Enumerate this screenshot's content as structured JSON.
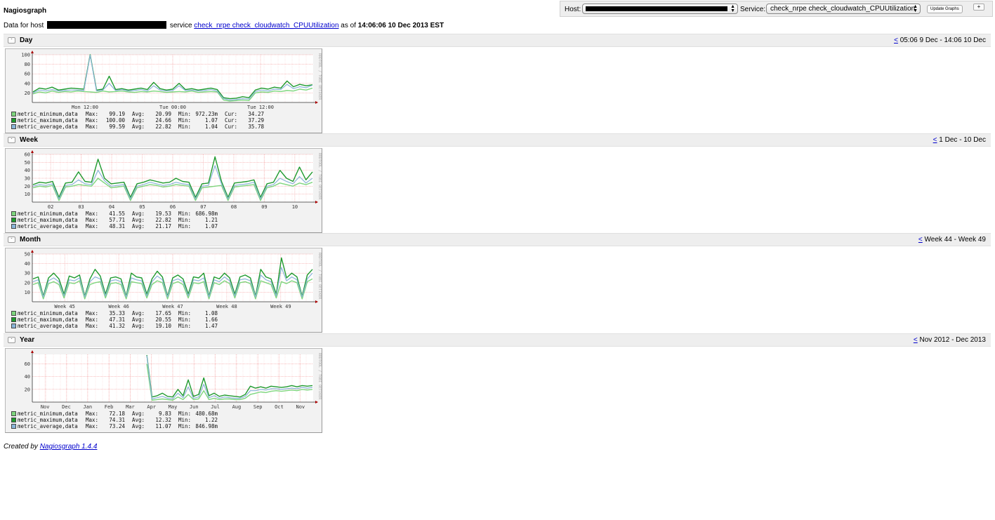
{
  "app_title": "Nagiosgraph",
  "controls": {
    "host_label": "Host:",
    "service_label": "Service:",
    "service_value": "check_nrpe check_cloudwatch_CPUUtilization",
    "update_label": "Update Graphs",
    "plus_label": "+"
  },
  "subtitle": {
    "prefix": "Data for host",
    "service_word": "service",
    "service_link": "check_nrpe check_cloudwatch_CPUUtilization",
    "as_of": "as of",
    "timestamp": "14:06:06 10 Dec 2013 EST"
  },
  "colors": {
    "metric_minimum": "#7ed67e",
    "metric_maximum": "#1f9a2e",
    "metric_average": "#8ab4d8",
    "grid_major": "#f08080",
    "grid_minor": "#fbd0d0"
  },
  "toggle_label": "-",
  "side_label": "RRDTOOL / TOBI OETIKER",
  "sections": [
    {
      "title": "Day",
      "back_link": "<",
      "period": "05:06 9 Dec - 14:06 10 Dec",
      "chart_data": {
        "type": "line",
        "ylim": [
          0,
          100
        ],
        "y_ticks": [
          20,
          40,
          60,
          80,
          100
        ],
        "x_ticks": [
          "Mon 12:00",
          "Tue 00:00",
          "Tue 12:00"
        ],
        "series": [
          {
            "name": "metric_minimum,data",
            "values": [
              18,
              22,
              20,
              24,
              21,
              23,
              22,
              24,
              23,
              22,
              21,
              24,
              22,
              23,
              24,
              22,
              21,
              23,
              22,
              24,
              23,
              21,
              22,
              23,
              22,
              24,
              21,
              22,
              23,
              22,
              5,
              3,
              4,
              5,
              4,
              20,
              22,
              21,
              24,
              23,
              25,
              24,
              28,
              26,
              30
            ]
          },
          {
            "name": "metric_maximum,data",
            "values": [
              22,
              30,
              28,
              32,
              26,
              28,
              30,
              29,
              28,
              100,
              26,
              28,
              55,
              27,
              29,
              26,
              28,
              30,
              27,
              42,
              29,
              26,
              28,
              40,
              27,
              29,
              26,
              28,
              30,
              27,
              10,
              8,
              9,
              12,
              10,
              26,
              30,
              28,
              32,
              30,
              45,
              33,
              38,
              35,
              37
            ]
          },
          {
            "name": "metric_average,data",
            "values": [
              20,
              26,
              24,
              27,
              24,
              25,
              26,
              26,
              25,
              99,
              24,
              26,
              40,
              25,
              27,
              24,
              25,
              27,
              24,
              35,
              26,
              24,
              25,
              35,
              25,
              26,
              24,
              25,
              27,
              24,
              8,
              5,
              6,
              8,
              7,
              23,
              26,
              24,
              28,
              27,
              38,
              29,
              33,
              31,
              36
            ]
          }
        ],
        "legend": [
          {
            "name": "metric_minimum,data",
            "max": "99.19",
            "avg": "20.99",
            "min": "972.23m",
            "cur": "34.27"
          },
          {
            "name": "metric_maximum,data",
            "max": "100.00",
            "avg": "24.66",
            "min": "1.07",
            "cur": "37.29"
          },
          {
            "name": "metric_average,data",
            "max": "99.59",
            "avg": "22.82",
            "min": "1.04",
            "cur": "35.78"
          }
        ]
      }
    },
    {
      "title": "Week",
      "back_link": "<",
      "period": "1 Dec - 10 Dec",
      "chart_data": {
        "type": "line",
        "ylim": [
          0,
          60
        ],
        "y_ticks": [
          10,
          20,
          30,
          40,
          50,
          60
        ],
        "x_ticks": [
          "02",
          "03",
          "04",
          "05",
          "06",
          "07",
          "08",
          "09",
          "10"
        ],
        "series": [
          {
            "name": "metric_minimum,data",
            "values": [
              18,
              20,
              19,
              21,
              2,
              19,
              20,
              22,
              21,
              20,
              30,
              24,
              18,
              19,
              20,
              2,
              18,
              20,
              22,
              21,
              19,
              20,
              22,
              21,
              20,
              2,
              18,
              19,
              20,
              21,
              2,
              19,
              20,
              21,
              22,
              2,
              18,
              20,
              24,
              22,
              20,
              24,
              22,
              25
            ]
          },
          {
            "name": "metric_maximum,data",
            "values": [
              22,
              25,
              24,
              26,
              6,
              24,
              25,
              38,
              26,
              25,
              54,
              30,
              23,
              24,
              25,
              6,
              23,
              25,
              28,
              26,
              24,
              25,
              30,
              26,
              25,
              6,
              23,
              24,
              57,
              26,
              6,
              24,
              25,
              26,
              28,
              6,
              23,
              25,
              40,
              30,
              26,
              44,
              28,
              38
            ]
          },
          {
            "name": "metric_average,data",
            "values": [
              20,
              22,
              21,
              23,
              4,
              21,
              22,
              28,
              23,
              22,
              40,
              27,
              20,
              21,
              22,
              4,
              20,
              22,
              25,
              23,
              21,
              22,
              25,
              23,
              22,
              4,
              20,
              21,
              46,
              23,
              4,
              21,
              22,
              23,
              25,
              4,
              20,
              22,
              30,
              26,
              23,
              32,
              24,
              30
            ]
          }
        ],
        "legend": [
          {
            "name": "metric_minimum,data",
            "max": "41.55",
            "avg": "19.53",
            "min": "686.98m",
            "cur": ""
          },
          {
            "name": "metric_maximum,data",
            "max": "57.71",
            "avg": "22.82",
            "min": "1.21",
            "cur": ""
          },
          {
            "name": "metric_average,data",
            "max": "48.31",
            "avg": "21.17",
            "min": "1.07",
            "cur": ""
          }
        ]
      }
    },
    {
      "title": "Month",
      "back_link": "<",
      "period": "Week 44 - Week 49",
      "chart_data": {
        "type": "line",
        "ylim": [
          0,
          50
        ],
        "y_ticks": [
          10,
          20,
          30,
          40,
          50
        ],
        "x_ticks": [
          "Week 45",
          "Week 46",
          "Week 47",
          "Week 48",
          "Week 49"
        ],
        "series": [
          {
            "name": "metric_minimum,data",
            "values": [
              18,
              20,
              3,
              19,
              21,
              18,
              4,
              20,
              19,
              22,
              3,
              18,
              20,
              21,
              4,
              19,
              20,
              18,
              3,
              21,
              20,
              19,
              4,
              18,
              22,
              20,
              3,
              19,
              21,
              18,
              4,
              20,
              19,
              21,
              3,
              20,
              18,
              22,
              19,
              4,
              20,
              21,
              19,
              3,
              22,
              20,
              18,
              4,
              21,
              19,
              22,
              20,
              3,
              21,
              24
            ]
          },
          {
            "name": "metric_maximum,data",
            "values": [
              24,
              26,
              6,
              25,
              30,
              24,
              8,
              27,
              25,
              28,
              6,
              24,
              34,
              27,
              8,
              25,
              26,
              24,
              6,
              30,
              26,
              25,
              8,
              24,
              32,
              26,
              6,
              25,
              28,
              24,
              8,
              26,
              25,
              30,
              6,
              26,
              24,
              30,
              25,
              8,
              26,
              28,
              25,
              6,
              34,
              26,
              24,
              8,
              46,
              25,
              30,
              26,
              6,
              28,
              34
            ]
          },
          {
            "name": "metric_average,data",
            "values": [
              21,
              23,
              5,
              22,
              25,
              21,
              6,
              23,
              22,
              25,
              5,
              21,
              26,
              24,
              6,
              22,
              23,
              21,
              5,
              25,
              23,
              22,
              6,
              21,
              27,
              23,
              5,
              22,
              24,
              21,
              6,
              23,
              22,
              25,
              5,
              23,
              21,
              26,
              22,
              6,
              23,
              24,
              22,
              5,
              28,
              23,
              21,
              6,
              36,
              22,
              26,
              23,
              5,
              24,
              30
            ]
          }
        ],
        "legend": [
          {
            "name": "metric_minimum,data",
            "max": "35.33",
            "avg": "17.65",
            "min": "1.08",
            "cur": ""
          },
          {
            "name": "metric_maximum,data",
            "max": "47.31",
            "avg": "20.55",
            "min": "1.66",
            "cur": ""
          },
          {
            "name": "metric_average,data",
            "max": "41.32",
            "avg": "19.10",
            "min": "1.47",
            "cur": ""
          }
        ]
      }
    },
    {
      "title": "Year",
      "back_link": "<",
      "period": "Nov 2012 - Dec 2013",
      "chart_data": {
        "type": "line",
        "ylim": [
          0,
          75
        ],
        "y_ticks": [
          20,
          40,
          60
        ],
        "x_ticks": [
          "Nov",
          "Dec",
          "Jan",
          "Feb",
          "Mar",
          "Apr",
          "May",
          "Jun",
          "Jul",
          "Aug",
          "Sep",
          "Oct",
          "Nov"
        ],
        "series": [
          {
            "name": "metric_minimum,data",
            "values": [
              null,
              null,
              null,
              null,
              null,
              null,
              null,
              null,
              null,
              null,
              null,
              null,
              null,
              null,
              null,
              null,
              null,
              null,
              null,
              null,
              null,
              null,
              60,
              3,
              4,
              5,
              4,
              3,
              8,
              4,
              12,
              4,
              5,
              18,
              4,
              6,
              4,
              5,
              5,
              4,
              4,
              6,
              12,
              14,
              16,
              15,
              17,
              18,
              17,
              18,
              19,
              18,
              20,
              19,
              20
            ]
          },
          {
            "name": "metric_maximum,data",
            "values": [
              null,
              null,
              null,
              null,
              null,
              null,
              null,
              null,
              null,
              null,
              null,
              null,
              null,
              null,
              null,
              null,
              null,
              null,
              null,
              null,
              null,
              null,
              74,
              8,
              10,
              14,
              9,
              8,
              20,
              10,
              35,
              9,
              12,
              38,
              10,
              14,
              9,
              11,
              10,
              9,
              8,
              12,
              25,
              22,
              24,
              22,
              25,
              24,
              23,
              24,
              26,
              24,
              26,
              25,
              26
            ]
          },
          {
            "name": "metric_average,data",
            "values": [
              null,
              null,
              null,
              null,
              null,
              null,
              null,
              null,
              null,
              null,
              null,
              null,
              null,
              null,
              null,
              null,
              null,
              null,
              null,
              null,
              null,
              null,
              73,
              5,
              7,
              9,
              6,
              5,
              14,
              7,
              24,
              6,
              8,
              28,
              7,
              10,
              6,
              8,
              7,
              6,
              6,
              9,
              18,
              18,
              20,
              19,
              21,
              21,
              20,
              21,
              22,
              21,
              23,
              22,
              23
            ]
          }
        ],
        "legend": [
          {
            "name": "metric_minimum,data",
            "max": "72.18",
            "avg": "9.83",
            "min": "480.68m",
            "cur": ""
          },
          {
            "name": "metric_maximum,data",
            "max": "74.31",
            "avg": "12.32",
            "min": "1.22",
            "cur": ""
          },
          {
            "name": "metric_average,data",
            "max": "73.24",
            "avg": "11.07",
            "min": "846.98m",
            "cur": ""
          }
        ]
      }
    }
  ],
  "legend_labels": {
    "max": "Max:",
    "avg": "Avg:",
    "min": "Min:",
    "cur": "Cur:"
  },
  "footer": {
    "prefix": "Created by",
    "link": "Nagiosgraph 1.4.4"
  }
}
